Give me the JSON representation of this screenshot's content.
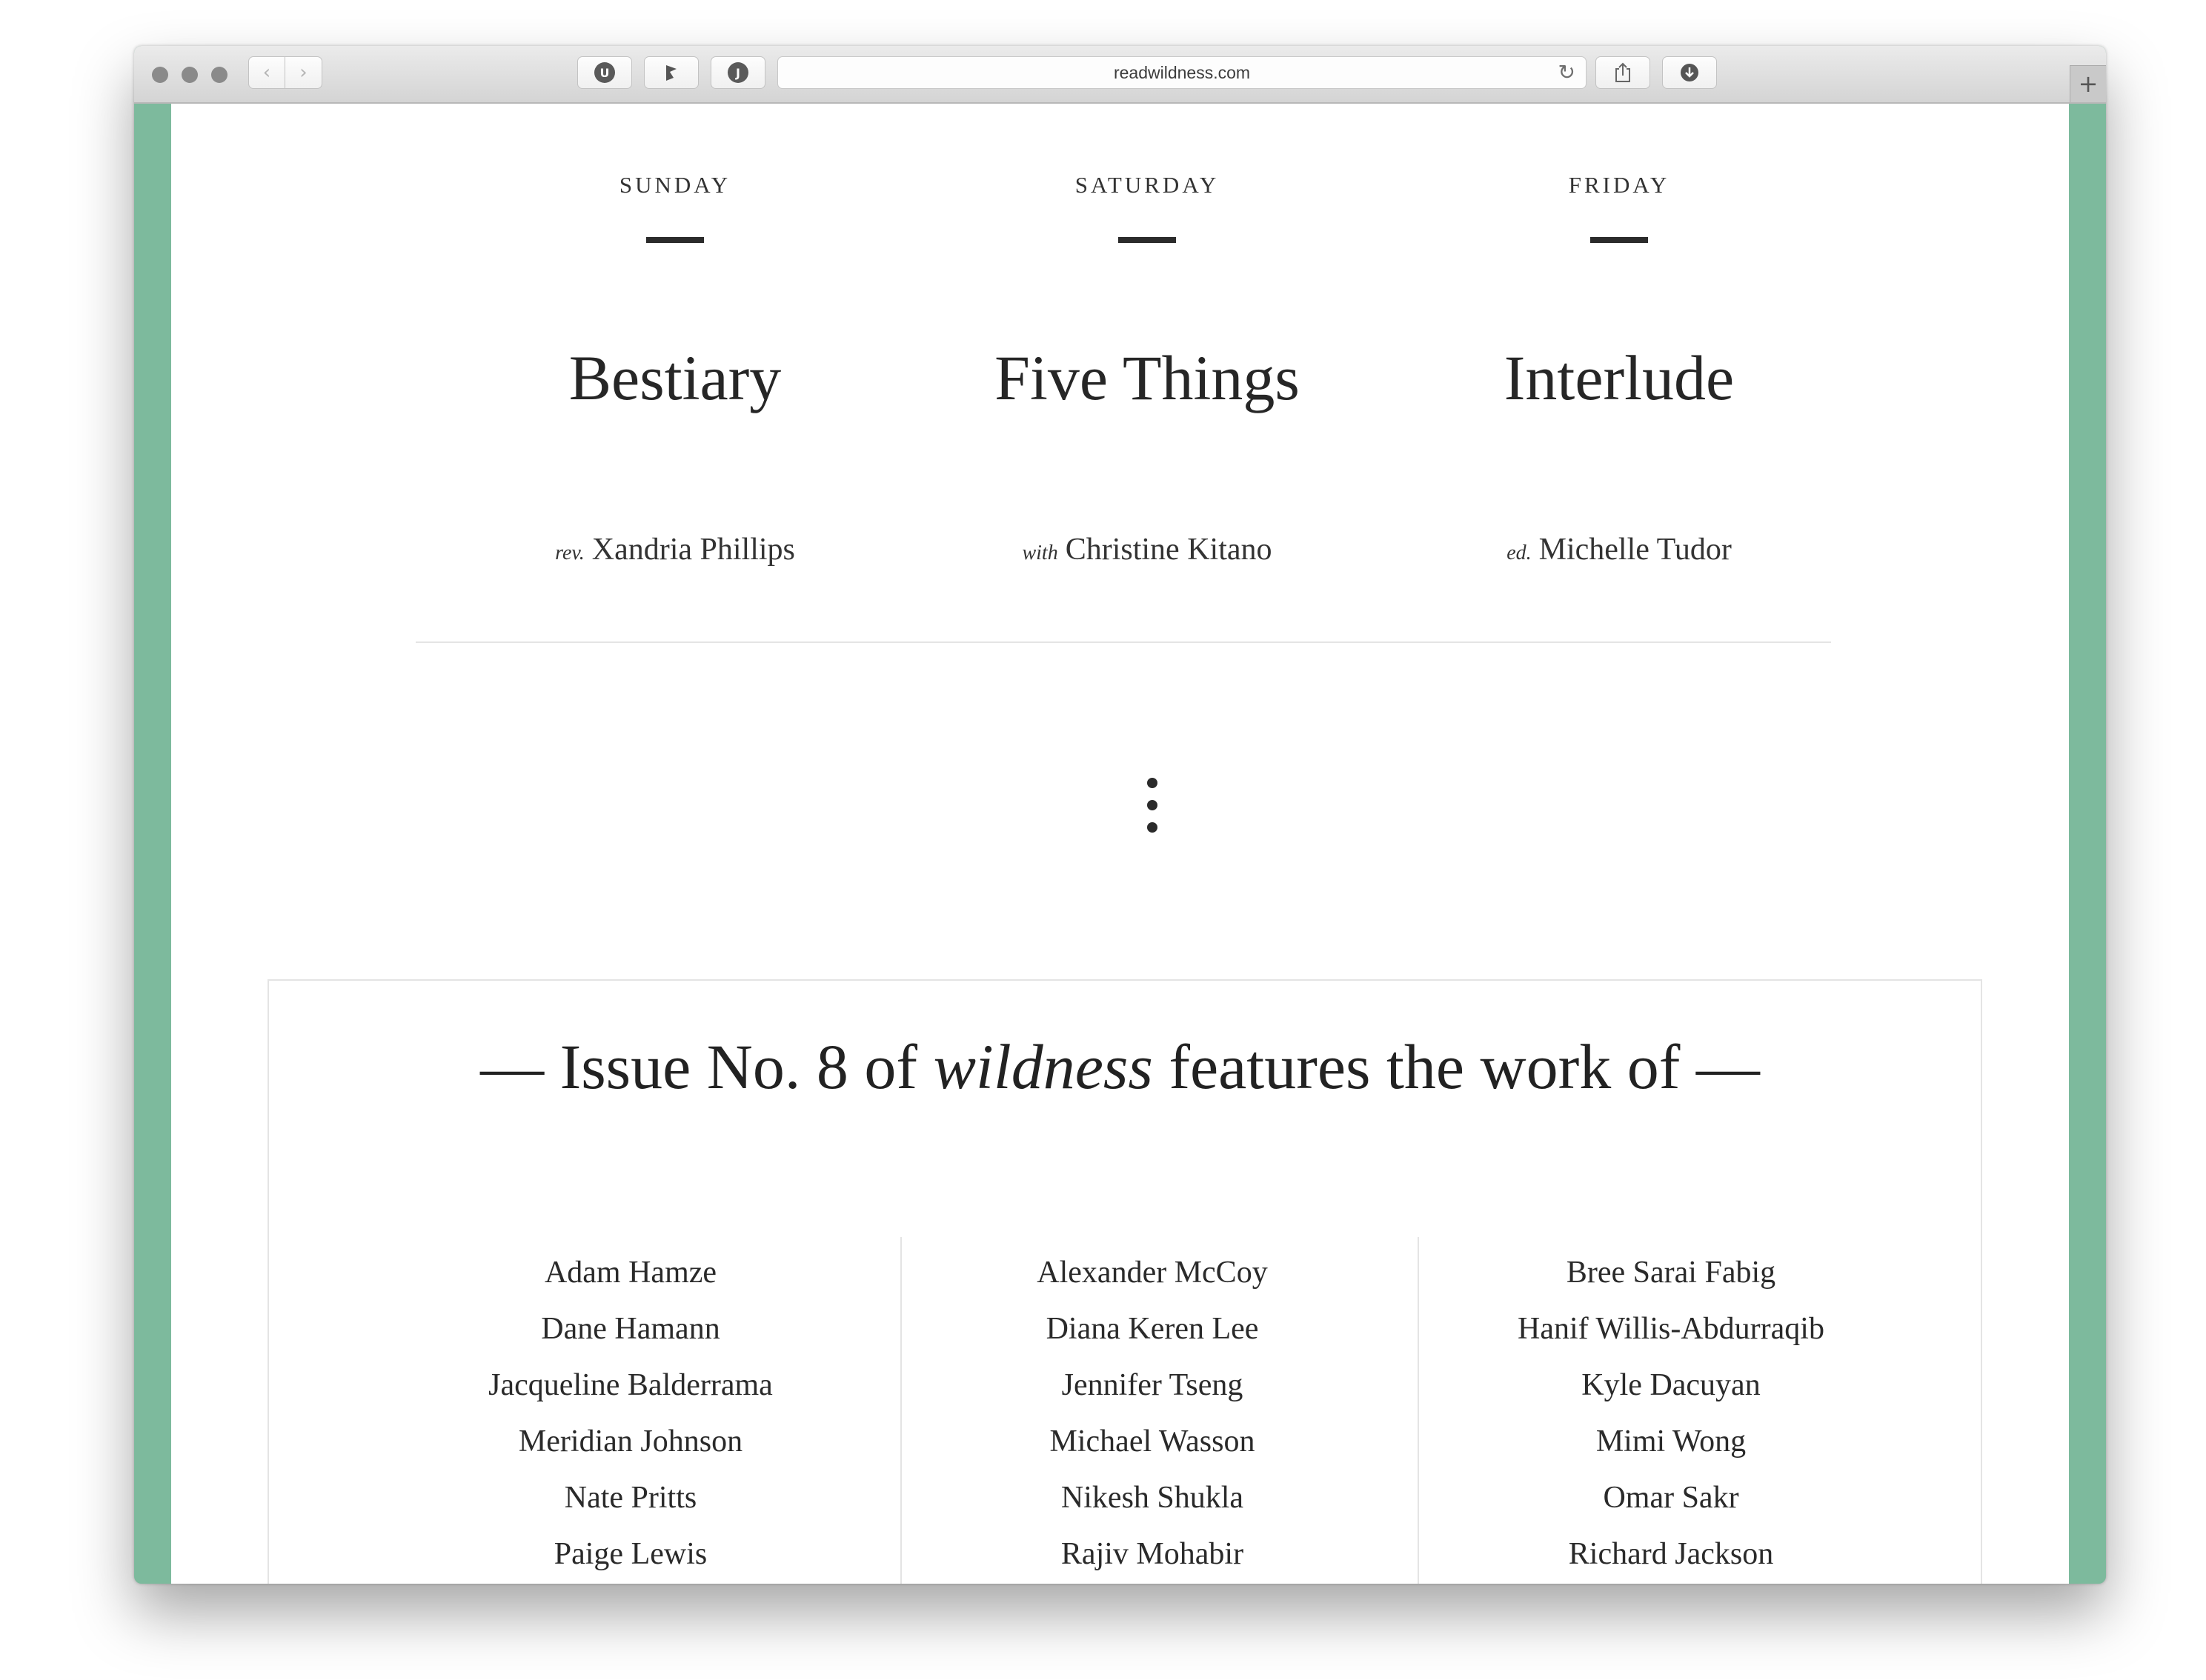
{
  "browser": {
    "url": "readwildness.com",
    "back_icon": "‹",
    "forward_icon": "›",
    "new_tab_icon": "+"
  },
  "colors": {
    "page_border": "#7dba9d",
    "text": "#222222"
  },
  "features": [
    {
      "day": "SUNDAY",
      "title": "Bestiary",
      "prefix": "rev.",
      "person": "Xandria Phillips"
    },
    {
      "day": "SATURDAY",
      "title": "Five Things",
      "prefix": "with",
      "person": "Christine Kitano"
    },
    {
      "day": "FRIDAY",
      "title": "Interlude",
      "prefix": "ed.",
      "person": "Michelle Tudor"
    }
  ],
  "issue": {
    "heading_before": "— Issue No. 8 of ",
    "heading_em": "wildness",
    "heading_after": " features the work of —",
    "columns": [
      [
        "Adam Hamze",
        "Dane Hamann",
        "Jacqueline Balderrama",
        "Meridian Johnson",
        "Nate Pritts",
        "Paige Lewis"
      ],
      [
        "Alexander McCoy",
        "Diana Keren Lee",
        "Jennifer Tseng",
        "Michael Wasson",
        "Nikesh Shukla",
        "Rajiv Mohabir"
      ],
      [
        "Bree Sarai Fabig",
        "Hanif Willis-Abdurraqib",
        "Kyle Dacuyan",
        "Mimi Wong",
        "Omar Sakr",
        "Richard Jackson"
      ]
    ]
  }
}
